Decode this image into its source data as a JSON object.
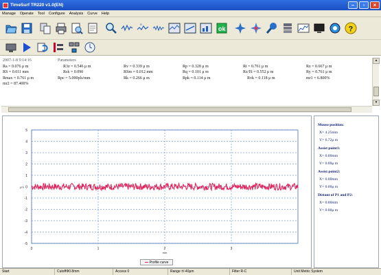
{
  "window": {
    "title": "TimeSurf TR220 v1.0(EN)"
  },
  "menu": {
    "items": [
      "Manage",
      "Operate",
      "Tool",
      "Configure",
      "Analysis",
      "Curve",
      "Help"
    ]
  },
  "toolbar1": [
    "open-icon",
    "save-icon",
    "copy-icon",
    "print-icon",
    "print-preview-icon",
    "page-preview-icon",
    "zoom-icon",
    "profile-curve-icon",
    "filter-curve-icon",
    "rough-curve-icon",
    "grid-toggle-icon",
    "chart-view-icon",
    "chart-compare-icon",
    "accept-icon",
    "crosshair-icon",
    "star-icon",
    "magnify-icon",
    "stack-icon",
    "spectrum-icon",
    "monitor-icon",
    "globe-icon",
    "help-icon"
  ],
  "toolbar2": [
    "measure-icon",
    "play-icon",
    "refresh-icon",
    "settings-icon",
    "network-icon",
    "timer-icon"
  ],
  "params": {
    "timestamp": "2007-1-8 9:14:16",
    "label": "Parameters",
    "rows": [
      [
        "Ra  =  0.076 μ m",
        "R3z  =  0.546 μ m",
        "Rv  =  0.339 μ m",
        "Rp  =  0.328 μ m",
        "Rt  =  0.761 μ m",
        "Rz  =  0.667 μ m"
      ],
      [
        "RS  =  0.011 mm",
        "Rsk  =  0.090",
        "RSm  =  0.012 mm",
        "Rq  =  0.101 μ m",
        "Rz/IS  =  0.552 μ m",
        "Ry  =  0.761 μ m"
      ],
      [
        "Rmax  =  0.761 μ m",
        "Rpc  =  5.000pls/mm",
        "Rk  =  0.266 μ m",
        "Rpk  =  0.114 μ m",
        "Rvk  =  0.118 μ m",
        "mr1  =  6.800%"
      ],
      [
        "mr2  =  87.400%"
      ]
    ]
  },
  "chart_data": {
    "type": "line",
    "xlabel": "mm",
    "ylabel": "μm",
    "xlim": [
      0,
      4
    ],
    "ylim": [
      -5,
      5
    ],
    "x_ticks": [
      "0",
      "1",
      "2",
      "3"
    ],
    "y_ticks": [
      "5",
      "4",
      "3",
      "2",
      "1",
      "0",
      "-1",
      "-2",
      "-3",
      "-4",
      "-5"
    ],
    "grid": true,
    "series": [
      {
        "color": "#e0245b",
        "mean": 0.0,
        "amplitude": 0.3,
        "points": 500
      }
    ]
  },
  "legend": {
    "tab_label": "Profile curve"
  },
  "side": {
    "mouse_title": "Mouse position:",
    "mouse_x": "X=  4.25mm",
    "mouse_y": "Y=  6.72μ m",
    "assist1_title": "Assist point1:",
    "assist1_x": "X=    0.00mm",
    "assist1_y": "Y=    0.00μ m",
    "assist2_title": "Assist point2:",
    "assist2_x": "X=    0.00mm",
    "assist2_y": "Y=    0.00μ m",
    "dist_title": "Distant of P1 and P2:",
    "dist_x": "X=    0.00mm",
    "dist_y": "Y=    0.00μ m"
  },
  "status": {
    "cells": [
      "Start",
      "CutoffΦ0.8mm",
      "Access 0",
      "Range ±/-40μm",
      "Filter R-C",
      "Unit Metric System"
    ]
  },
  "colors": {
    "titlebar": "#1b4fc4",
    "profile": "#e0245b",
    "grid": "#3f6fc4"
  }
}
